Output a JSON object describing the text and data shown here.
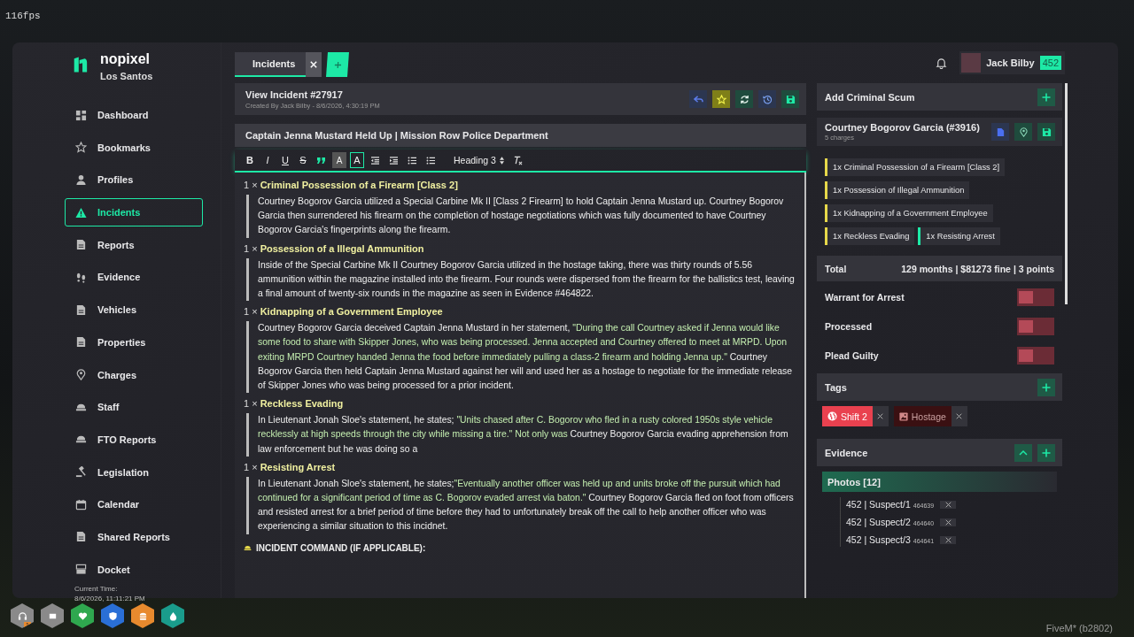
{
  "fps": "116fps",
  "brand": {
    "name": "nopixel",
    "city": "Los Santos"
  },
  "nav": [
    {
      "label": "Dashboard",
      "selected": false
    },
    {
      "label": "Bookmarks",
      "selected": false
    },
    {
      "label": "Profiles",
      "selected": false
    },
    {
      "label": "Incidents",
      "selected": true
    },
    {
      "label": "Reports",
      "selected": false
    },
    {
      "label": "Evidence",
      "selected": false
    },
    {
      "label": "Vehicles",
      "selected": false
    },
    {
      "label": "Properties",
      "selected": false
    },
    {
      "label": "Charges",
      "selected": false
    },
    {
      "label": "Staff",
      "selected": false
    },
    {
      "label": "FTO Reports",
      "selected": false
    },
    {
      "label": "Legislation",
      "selected": false
    },
    {
      "label": "Calendar",
      "selected": false
    },
    {
      "label": "Shared Reports",
      "selected": false
    },
    {
      "label": "Docket",
      "selected": false
    }
  ],
  "clock": {
    "label": "Current Time:",
    "value": "8/6/2026, 11:11:21 PM"
  },
  "tabs": [
    {
      "label": "Incidents",
      "selected": true
    }
  ],
  "user": {
    "name": "Jack Bilby",
    "callsign": "452"
  },
  "incident": {
    "title": "View Incident #27917",
    "meta": "Created By Jack Bilby - 8/6/2026, 4:30:19 PM",
    "name": "Captain Jenna Mustard Held Up | Mission Row Police Department"
  },
  "toolbar": [
    {
      "kind": "bold",
      "label": "B",
      "selected": false
    },
    {
      "kind": "italic",
      "label": "I",
      "selected": false
    },
    {
      "kind": "underline",
      "label": "U",
      "selected": false
    },
    {
      "kind": "strike",
      "label": "S",
      "selected": false
    },
    {
      "kind": "quote",
      "selected": false
    },
    {
      "kind": "highlight",
      "label": "A",
      "selected": false
    },
    {
      "kind": "color",
      "label": "A",
      "selected": true
    },
    {
      "kind": "outdent",
      "selected": false
    },
    {
      "kind": "indent",
      "selected": false
    },
    {
      "kind": "ordered",
      "selected": false
    },
    {
      "kind": "bullets",
      "selected": false
    },
    {
      "kind": "heading",
      "label": "Heading 3",
      "selected": false
    },
    {
      "kind": "clear",
      "selected": false
    }
  ],
  "charges": [
    {
      "count": "1 ×",
      "title": "Criminal Possession of a Firearm [Class 2]",
      "text": [
        {
          "kind": "plain",
          "text": "Courtney Bogorov Garcia utilized a Special Carbine Mk II [Class 2 Firearm] to hold Captain Jenna Mustard up. Courtney Bogorov Garcia then surrendered his firearm on the completion of hostage negotiations which was fully documented to have Courtney Bogorov Garcia's fingerprints along the firearm."
        }
      ]
    },
    {
      "count": "1 ×",
      "title": "Possession of a Illegal Ammunition",
      "text": [
        {
          "kind": "plain",
          "text": "Inside of the Special Carbine Mk II Courtney Bogorov Garcia utilized in the hostage taking, there was thirty rounds of 5.56 ammunition within the magazine installed into the firearm. Four rounds were dispersed from the firearm for the ballistics test, leaving a final amount of twenty-six rounds in the magazine as seen in Evidence #464822."
        }
      ]
    },
    {
      "count": "1 ×",
      "title": "Kidnapping of a Government Employee",
      "text": [
        {
          "kind": "plain",
          "text": "Courtney Bogorov Garcia deceived Captain Jenna Mustard in her statement, "
        },
        {
          "kind": "quote",
          "text": "\"During the call Courtney asked if Jenna would like some food to share with Skipper Jones, who was being processed. Jenna accepted and Courtney offered to meet at MRPD. Upon exiting MRPD Courtney handed Jenna the food before immediately pulling a class-2 firearm and holding Jenna up.\""
        },
        {
          "kind": "plain",
          "text": "  Courtney Bogorov Garcia then held Captain Jenna Mustard against her will and used her as a hostage to negotiate for the immediate release of Skipper Jones who was being processed for a prior incident."
        }
      ]
    },
    {
      "count": "1 ×",
      "title": "Reckless Evading",
      "text": [
        {
          "kind": "plain",
          "text": "In Lieutenant Jonah Sloe's statement, he states; "
        },
        {
          "kind": "quote",
          "text": "\"Units chased after C. Bogorov who fled in a rusty colored 1950s style vehicle recklessly at high speeds through the city while missing a tire.\" Not only was "
        },
        {
          "kind": "plain",
          "text": "Courtney Bogorov Garcia evading apprehension from law enforcement but he was doing so a"
        }
      ]
    },
    {
      "count": "1 ×",
      "title": "Resisting Arrest",
      "text": [
        {
          "kind": "plain",
          "text": "In Lieutenant Jonah Sloe's statement, he states;"
        },
        {
          "kind": "quote",
          "text": "\"Eventually another officer was held up and units broke off the pursuit which had continued for a significant period of time as C. Bogorov evaded arrest via baton.\""
        },
        {
          "kind": "plain",
          "text": " Courtney Bogorov Garcia fled on foot from officers and resisted arrest for a brief period of time before they had to unfortunately break off the call to help another officer who was experiencing a similar situation to this incidnet."
        }
      ]
    }
  ],
  "section_heading": "INCIDENT COMMAND (IF APPLICABLE):",
  "criminals": {
    "title": "Add Criminal Scum",
    "suspect": "Courtney Bogorov Garcia (#3916)",
    "charge_count": "5 charges",
    "charges": [
      {
        "label": "1x Criminal Possession of a Firearm [Class 2]",
        "color": "#e6d84a"
      },
      {
        "label": "1x Possession of Illegal Ammunition",
        "color": "#e6d84a"
      },
      {
        "label": "1x Kidnapping of a Government Employee",
        "color": "#e6d84a"
      },
      {
        "label": "1x Reckless Evading",
        "color": "#e6d84a"
      },
      {
        "label": "1x Resisting Arrest",
        "color": "#1de9a6"
      }
    ],
    "total_label": "Total",
    "total": "129 months | $81273 fine | 3 points",
    "toggles": [
      {
        "label": "Warrant for Arrest",
        "on": false
      },
      {
        "label": "Processed",
        "on": false
      },
      {
        "label": "Plead Guilty",
        "on": false
      }
    ]
  },
  "tags": {
    "title": "Tags",
    "items": [
      {
        "label": "Shift 2",
        "color": "#e9414f"
      },
      {
        "label": "Hostage",
        "color": "#3a1012"
      }
    ]
  },
  "evidence": {
    "title": "Evidence",
    "group": "Photos [12]",
    "items": [
      {
        "label": "452 | Suspect/1",
        "id": "464639"
      },
      {
        "label": "452 | Suspect/2",
        "id": "464640"
      },
      {
        "label": "452 | Suspect/3",
        "id": "464641"
      }
    ]
  },
  "hud": [
    {
      "color": "#8a8a8a",
      "badge": "1"
    },
    {
      "color": "#8a8a8a"
    },
    {
      "color": "#2fa84f"
    },
    {
      "color": "#2a6fd6"
    },
    {
      "color": "#e88a2e"
    },
    {
      "color": "#1a9c8c"
    }
  ],
  "build": "FiveM* (b2802)"
}
